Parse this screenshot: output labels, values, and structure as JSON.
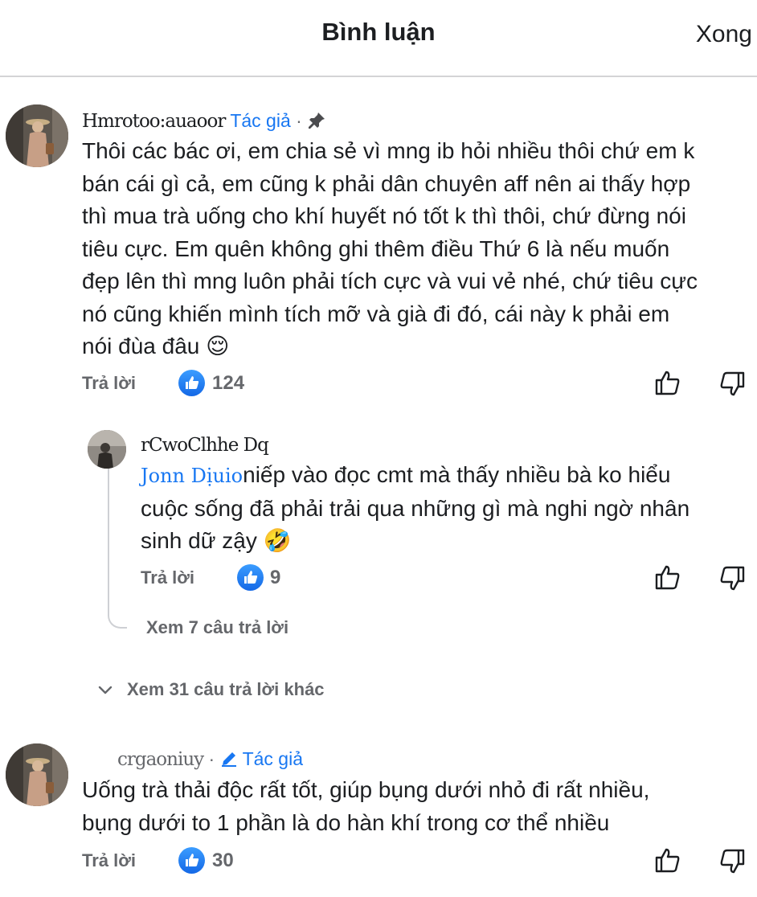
{
  "header": {
    "title": "Bình luận",
    "done_label": "Xong"
  },
  "comments": [
    {
      "name": "Hmrotoo:auaoor",
      "author_badge": "Tác giả",
      "separator": "·",
      "text_lines": [
        "Thôi các bác ơi, em chia sẻ vì mng ib hỏi nhiều thôi chứ em k",
        "bán cái gì cả, em cũng k phải dân chuyên aff nên ai thấy hợp",
        "thì mua trà uống cho khí huyết nó tốt k thì thôi, chứ đừng nói",
        "tiêu cực. Em quên không ghi thêm điều Thứ 6 là nếu muốn",
        "đẹp lên thì mng luôn phải tích cực và vui vẻ nhé, chứ tiêu cực",
        "nó cũng khiến mình tích mỡ và già đi đó, cái này k phải em",
        "nói đùa đâu 😌"
      ],
      "reply_label": "Trả lời",
      "like_count": "124"
    },
    {
      "name": "rCwoClhhe  Dq",
      "mention": "Jonn Dịuio",
      "text_lines": [
        "niếp vào đọc cmt mà thấy nhiều bà ko hiểu",
        "cuộc sống đã phải trải qua những gì mà nghi ngờ nhân",
        "sinh dữ zậy 🤣"
      ],
      "reply_label": "Trả lời",
      "like_count": "9",
      "view_replies": "Xem 7 câu trả lời"
    },
    {
      "name": "crgaoniuy",
      "author_badge": "Tác giả",
      "separator": "·",
      "text_lines": [
        "Uống trà thải độc rất tốt, giúp bụng dưới nhỏ đi rất nhiều,",
        "bụng dưới to 1 phần là do hàn khí trong cơ thể nhiều"
      ],
      "reply_label": "Trả lời",
      "like_count": "30"
    }
  ],
  "more_replies": "Xem 31 câu trả lời khác",
  "colors": {
    "accent": "#1877f2",
    "muted": "#65676b",
    "text": "#1c1e21"
  },
  "icons": [
    "pin-icon",
    "pencil-icon",
    "like-reaction-icon",
    "thumbs-up-icon",
    "thumbs-down-icon",
    "chevron-down-icon"
  ]
}
